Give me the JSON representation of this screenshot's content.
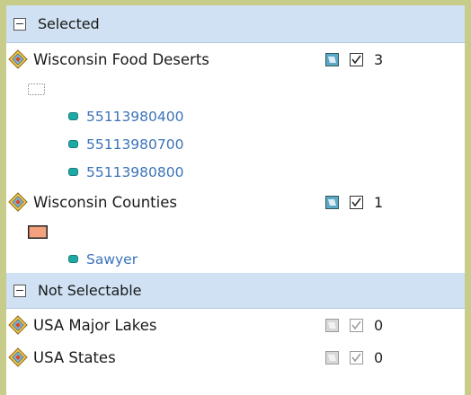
{
  "groups": [
    {
      "title": "Selected",
      "toggle": "collapse",
      "layers": [
        {
          "name": "Wisconsin Food Deserts",
          "count": "3",
          "symbol": "dotted-outline",
          "features": [
            "55113980400",
            "55113980700",
            "55113980800"
          ]
        },
        {
          "name": "Wisconsin Counties",
          "count": "1",
          "symbol": "salmon-fill",
          "features": [
            "Sawyer"
          ]
        }
      ]
    },
    {
      "title": "Not Selectable",
      "toggle": "collapse",
      "layers": [
        {
          "name": "USA Major Lakes",
          "count": "0"
        },
        {
          "name": "USA States",
          "count": "0"
        }
      ]
    }
  ],
  "colors": {
    "background": "#c8cc8a",
    "group_header": "#cfe1f2",
    "feature_link": "#3c74b8",
    "feature_icon": "#1fa9a4",
    "county_fill": "#f4a27e"
  },
  "icons": {
    "layer": "layer-diamond-icon",
    "select_toggle": "selectable-toggle-icon",
    "show_selected": "show-selected-icon",
    "feature": "feature-icon",
    "collapse": "collapse-icon"
  }
}
